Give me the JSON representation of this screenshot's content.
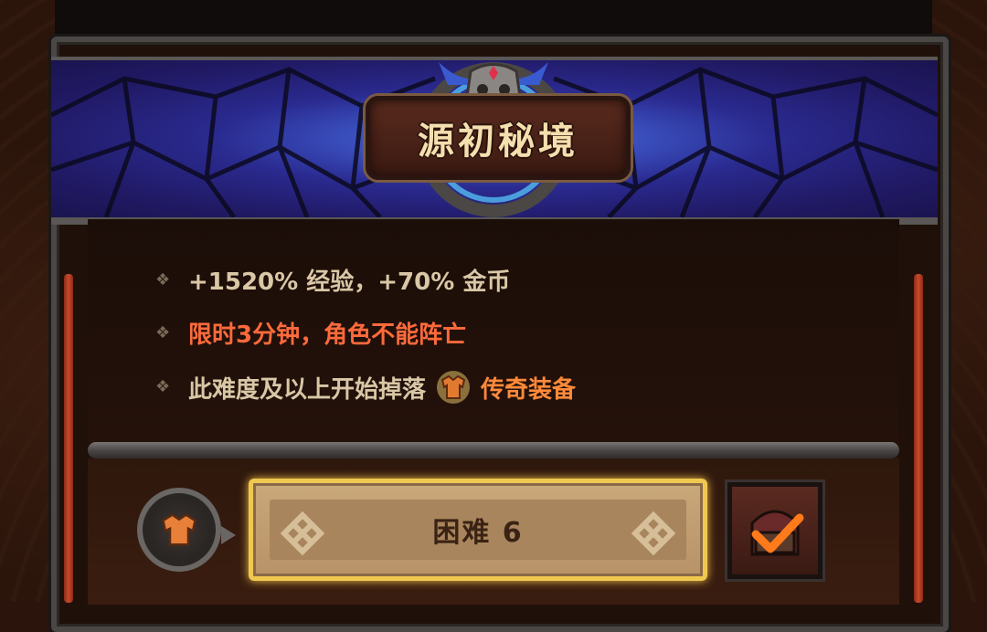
{
  "header": {
    "title": "源初秘境"
  },
  "rewards": [
    {
      "text": "+1520% 经验，+70% 金币",
      "style": "normal"
    },
    {
      "text": "限时3分钟，角色不能阵亡",
      "style": "red"
    }
  ],
  "drop_line": {
    "prefix": "此难度及以上开始掉落",
    "item": "传奇装备",
    "icon": "armor-icon"
  },
  "difficulty": {
    "label": "困难 6"
  },
  "colors": {
    "banner": "#2a2a8f",
    "warning": "#ff6a3c",
    "legendary": "#ff8a3a",
    "selected_border": "#f0c850"
  }
}
